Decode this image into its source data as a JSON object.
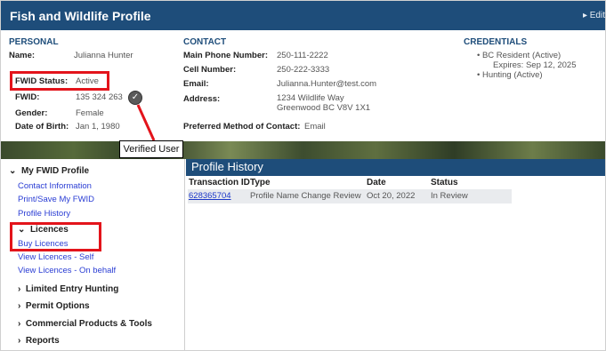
{
  "header": {
    "title": "Fish and Wildlife Profile",
    "edit_label": "▸ Edit"
  },
  "personal": {
    "heading": "PERSONAL",
    "name_label": "Name:",
    "name": "Julianna Hunter",
    "status_label": "FWID Status:",
    "status": "Active",
    "fwid_label": "FWID:",
    "fwid": "135 324 263",
    "gender_label": "Gender:",
    "gender": "Female",
    "dob_label": "Date of Birth:",
    "dob": "Jan 1, 1980"
  },
  "contact": {
    "heading": "CONTACT",
    "main_phone_label": "Main Phone Number:",
    "main_phone": "250-111-2222",
    "cell_label": "Cell Number:",
    "cell": "250-222-3333",
    "email_label": "Email:",
    "email": "Julianna.Hunter@test.com",
    "address_label": "Address:",
    "address_line1": "1234 Wildlife Way",
    "address_line2": "Greenwood BC V8V 1X1",
    "preferred_label": "Preferred Method of Contact:",
    "preferred": "Email"
  },
  "credentials": {
    "heading": "CREDENTIALS",
    "item1": "BC Resident (Active)",
    "item1_sub": "Expires: Sep 12, 2025",
    "item2": "Hunting (Active)"
  },
  "callout": {
    "text": "Verified User"
  },
  "sidebar": {
    "profile_heading": "My FWID Profile",
    "contact_info": "Contact Information",
    "print_save": "Print/Save My FWID",
    "profile_history": "Profile History",
    "licences_heading": "Licences",
    "buy_licences": "Buy Licences",
    "view_self": "View Licences - Self",
    "view_behalf": "View Licences - On behalf",
    "limited_entry": "Limited Entry Hunting",
    "permit_options": "Permit Options",
    "commercial": "Commercial Products & Tools",
    "reports": "Reports"
  },
  "history": {
    "title": "Profile History",
    "columns": [
      "Transaction ID",
      "Type",
      "Date",
      "Status"
    ],
    "rows": [
      {
        "id": "628365704",
        "type": "Profile Name Change Review",
        "date": "Oct 20, 2022",
        "status": "In Review"
      }
    ]
  },
  "colors": {
    "header_bg": "#1e4d7a",
    "highlight": "#e3141b",
    "link": "#2a3dd4"
  }
}
